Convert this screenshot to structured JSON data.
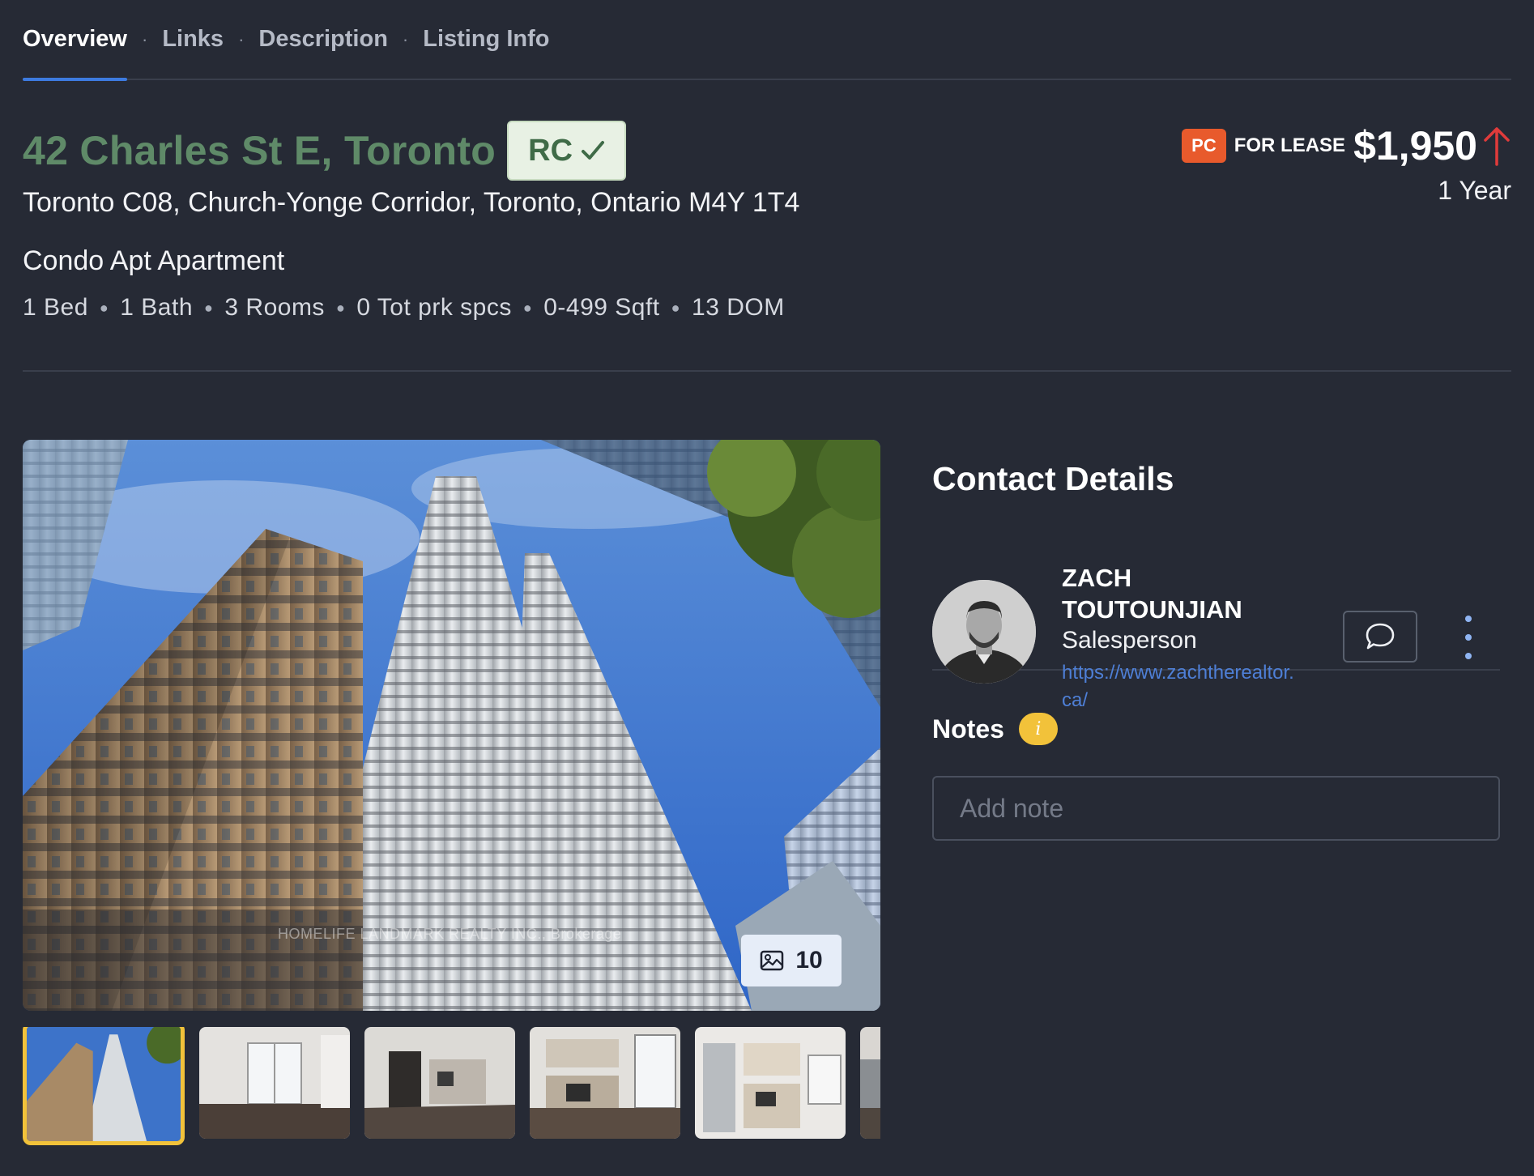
{
  "tabs": [
    {
      "label": "Overview",
      "active": true
    },
    {
      "label": "Links"
    },
    {
      "label": "Description"
    },
    {
      "label": "Listing Info"
    }
  ],
  "tab_separator": "·",
  "listing": {
    "address": "42 Charles St E, Toronto",
    "badge": "RC",
    "subaddress": "Toronto C08, Church-Yonge Corridor, Toronto, Ontario M4Y 1T4",
    "property_type": "Condo Apt Apartment",
    "specs": [
      "1 Bed",
      "1 Bath",
      "3 Rooms",
      "0 Tot prk spcs",
      "0-499 Sqft",
      "13 DOM"
    ],
    "status_badge": "PC",
    "status_label": "FOR LEASE",
    "price": "$1,950",
    "term": "1 Year"
  },
  "gallery": {
    "watermark": "HOMELIFE LANDMARK REALTY INC., Brokerage",
    "photo_count": "10",
    "thumbnails": [
      "exterior",
      "living-room",
      "kitchen-hall",
      "kitchen",
      "kitchen-appliances",
      "partial"
    ]
  },
  "contact": {
    "title": "Contact Details",
    "agent_name_line1": "ZACH",
    "agent_name_line2": "TOUTOUNJIAN",
    "agent_role": "Salesperson",
    "agent_link_line1": "https://www.zachtherealtor.",
    "agent_link_line2": "ca/"
  },
  "notes": {
    "title": "Notes",
    "info_icon": "i",
    "placeholder": "Add note"
  },
  "colors": {
    "background": "#262a35",
    "address_green": "#5f8a68",
    "status_orange": "#e85a2c",
    "price_arrow_red": "#e03b3b",
    "link_blue": "#4e7fd6",
    "active_tab_underline": "#3d7be0",
    "selected_thumb": "#f2c23a"
  }
}
